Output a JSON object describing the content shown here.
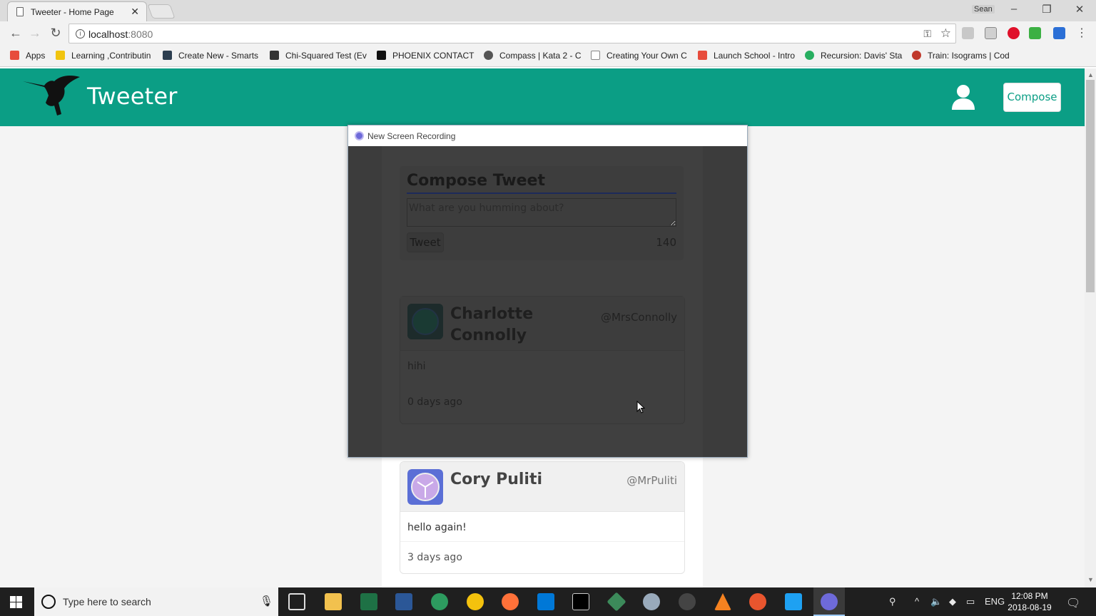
{
  "browser": {
    "tab_title": "Tweeter - Home Page",
    "tab_close": "✕",
    "window_user": "Sean",
    "url_host": "localhost",
    "url_port": ":8080",
    "bookmarks": [
      {
        "label": "Apps",
        "color": "#e74c3c"
      },
      {
        "label": "Learning ,Contributin",
        "color": "#f1c40f"
      },
      {
        "label": "Create New - Smarts",
        "color": "#2c3e50"
      },
      {
        "label": "Chi-Squared Test (Ev",
        "color": "#333333"
      },
      {
        "label": "PHOENIX CONTACT |",
        "color": "#111111"
      },
      {
        "label": "Compass | Kata 2 - C",
        "color": "#555555"
      },
      {
        "label": "Creating Your Own C",
        "color": "#888888"
      },
      {
        "label": "Launch School - Intro",
        "color": "#e74c3c"
      },
      {
        "label": "Recursion: Davis' Sta",
        "color": "#27ae60"
      },
      {
        "label": "Train: Isograms | Cod",
        "color": "#c0392b"
      }
    ]
  },
  "header": {
    "brand": "Tweeter",
    "compose_label": "Compose",
    "accent_color": "#0b9e85"
  },
  "recording": {
    "title": "New Screen Recording",
    "compose": {
      "title": "Compose Tweet",
      "placeholder": "What are you humming about?",
      "button": "Tweet",
      "counter": "140"
    },
    "tweet": {
      "name": "Charlotte Connolly",
      "handle": "@MrsConnolly",
      "text": "hihi",
      "time": "0 days ago"
    }
  },
  "tweets": [
    {
      "name": "Cory Puliti",
      "handle": "@MrPuliti",
      "text": "hello again!",
      "time": "3 days ago"
    }
  ],
  "taskbar": {
    "search_placeholder": "Type here to search",
    "language": "ENG",
    "time": "12:08 PM",
    "date": "2018-08-19"
  }
}
